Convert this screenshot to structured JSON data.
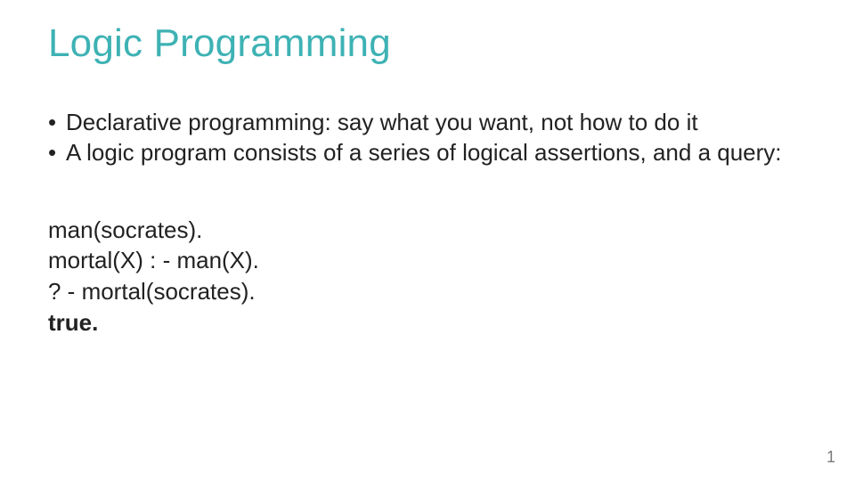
{
  "title": {
    "text": "Logic Programming",
    "color": "#3eb2b4"
  },
  "bullets": [
    "Declarative programming: say what you want, not how to do it",
    "A logic program consists of a series of logical assertions, and a query:"
  ],
  "bullet_marker": "•",
  "code": {
    "lines": [
      "man(socrates).",
      "mortal(X) : - man(X).",
      "? - mortal(socrates)."
    ],
    "result": "true."
  },
  "page_number": "1"
}
